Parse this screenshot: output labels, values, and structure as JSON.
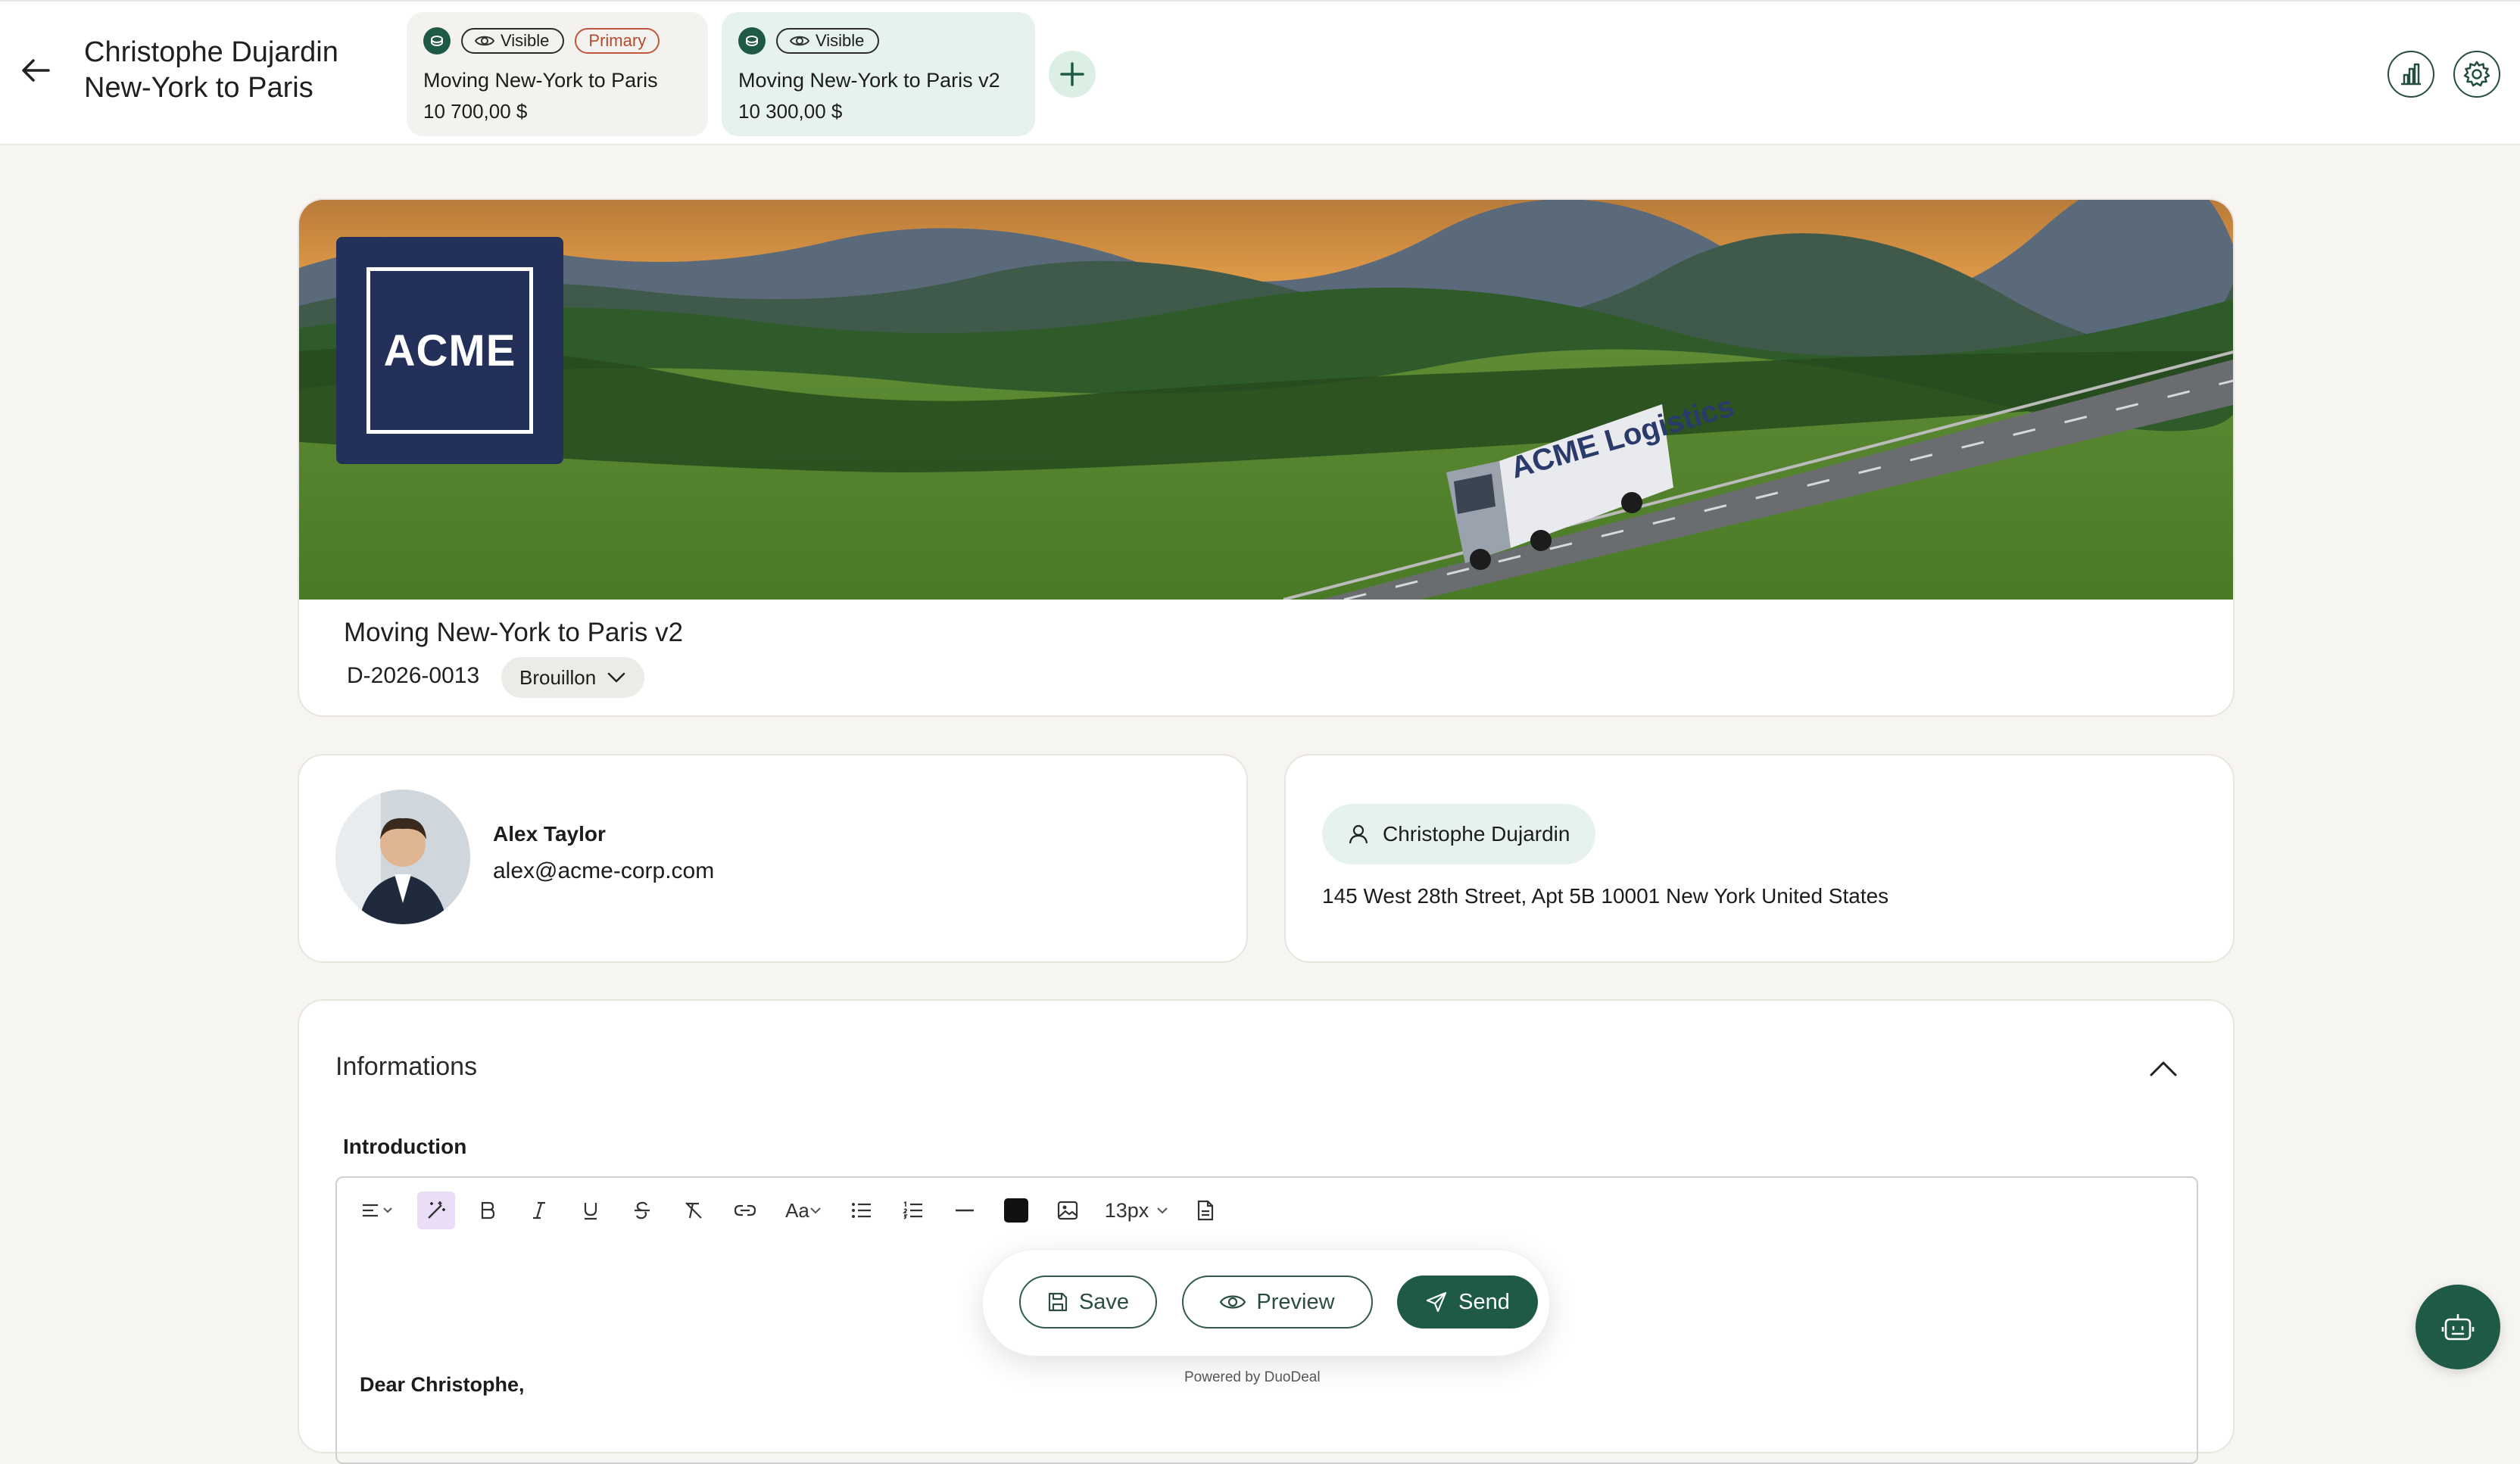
{
  "header": {
    "title_line1": "Christophe Dujardin",
    "title_line2": "New-York to Paris",
    "tabs": [
      {
        "visibility": "Visible",
        "badge": "Primary",
        "name": "Moving New-York to Paris",
        "price": "10 700,00 $"
      },
      {
        "visibility": "Visible",
        "badge": "",
        "name": "Moving New-York to Paris v2",
        "price": "10 300,00 $"
      }
    ],
    "icons": {
      "back": "arrow-left-icon",
      "add": "plus-icon",
      "stats": "bar-chart-icon",
      "settings": "gear-icon"
    }
  },
  "hero": {
    "logo_text": "ACME",
    "truck_brand": "ACME Logistics",
    "quote_title": "Moving New-York to Paris v2",
    "reference": "D-2026-0013",
    "status": "Brouillon"
  },
  "sender": {
    "name": "Alex Taylor",
    "email": "alex@acme-corp.com"
  },
  "client": {
    "name": "Christophe Dujardin",
    "address": "145 West 28th Street, Apt 5B 10001 New York United States"
  },
  "informations": {
    "title": "Informations",
    "intro_label": "Introduction",
    "font_size": "13px",
    "text_style_label": "Aa",
    "greeting": "Dear Christophe,"
  },
  "actions": {
    "save": "Save",
    "preview": "Preview",
    "send": "Send",
    "powered_by": "Powered by DuoDeal"
  },
  "colors": {
    "brand_green": "#1f5a46",
    "light_green": "#e6f3ec",
    "primary_badge": "#b54a2e",
    "logo_navy": "#23305a"
  }
}
